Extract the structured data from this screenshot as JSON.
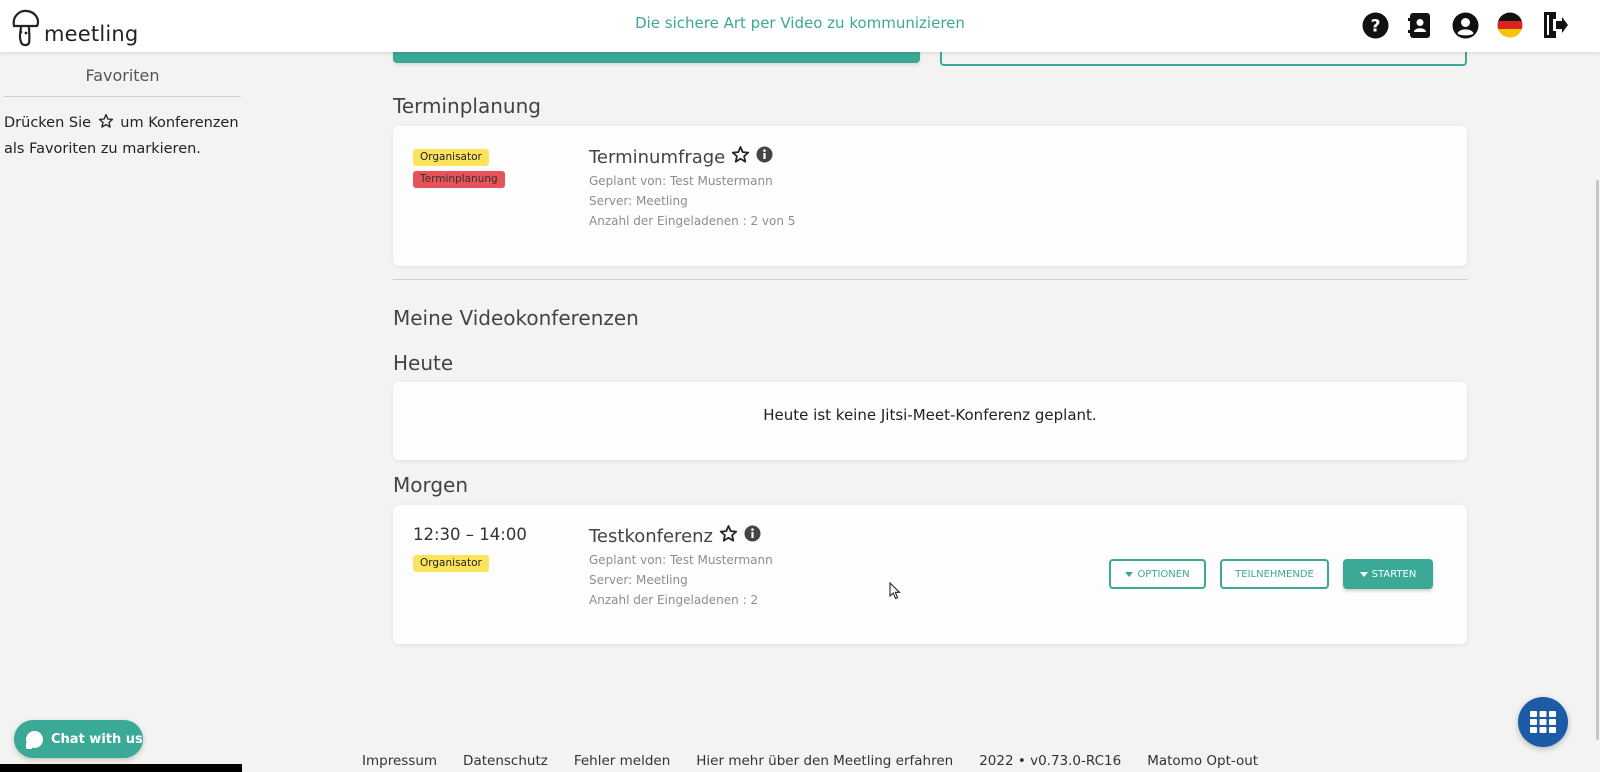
{
  "header": {
    "logo_text": "meetling",
    "tagline": "Die sichere Art per Video zu kommunizieren",
    "icons": [
      "help-icon",
      "contacts-icon",
      "account-icon",
      "german-flag-icon",
      "logout-icon"
    ]
  },
  "sidebar": {
    "title": "Favoriten",
    "hint_before": "Drücken Sie",
    "hint_after": "um Konferenzen als Favoriten zu markieren."
  },
  "chat": {
    "label": "Chat with us"
  },
  "scheduling": {
    "section_title": "Terminplanung",
    "card": {
      "badges": [
        "Organisator",
        "Terminplanung"
      ],
      "title": "Terminumfrage",
      "planned_by": "Geplant von: Test Mustermann",
      "server": "Server: Meetling",
      "invited": "Anzahl der Eingeladenen : 2 von 5"
    }
  },
  "conferences": {
    "section_title": "Meine Videokonferenzen",
    "today": {
      "title": "Heute",
      "empty_text": "Heute ist keine Jitsi-Meet-Konferenz geplant."
    },
    "tomorrow": {
      "title": "Morgen",
      "card": {
        "time": "12:30 – 14:00",
        "badge": "Organisator",
        "title": "Testkonferenz",
        "planned_by": "Geplant von: Test Mustermann",
        "server": "Server: Meetling",
        "invited": "Anzahl der Eingeladenen : 2",
        "options_label": "OPTIONEN",
        "participants_label": "TEILNEHMENDE",
        "start_label": "STARTEN"
      }
    }
  },
  "footer": {
    "links": [
      "Impressum",
      "Datenschutz",
      "Fehler melden",
      "Hier mehr über den Meetling erfahren",
      "2022 • v0.73.0-RC16",
      "Matomo Opt-out"
    ]
  },
  "colors": {
    "accent": "#3aa996",
    "badge_yellow": "#fbe35b",
    "badge_red": "#e8525a",
    "apps_button": "#1c5ba6"
  }
}
